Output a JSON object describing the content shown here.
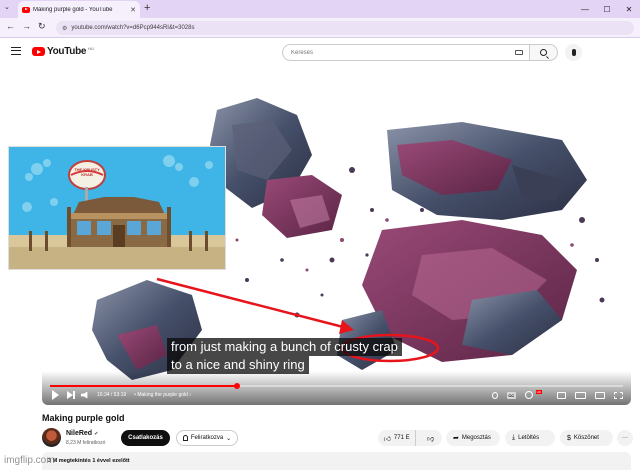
{
  "browser": {
    "tab_title": "Making purple gold - YouTube",
    "tab_close": "✕",
    "new_tab": "+",
    "tab_list": "⌄",
    "url": "youtube.com/watch?v=d6Pcp944sRI&t=3028s",
    "win_min": "—",
    "win_max": "☐",
    "win_close": "✕"
  },
  "header": {
    "logo_text": "YouTube",
    "logo_country": "HU",
    "search_placeholder": "Keresés"
  },
  "player": {
    "progress": 0.327,
    "time": "16:34 / 53:19",
    "chapter": "• Making the purple gold  ›",
    "captions": [
      "from just making a bunch of crusty crap",
      "to a nice and shiny ring"
    ],
    "inset_sign": "THE KRUSTY KRAB",
    "accent": "#ff0000",
    "annotation_color": "#e8141c"
  },
  "video": {
    "title": "Making purple gold",
    "channel": "NileRed",
    "verified": "✔",
    "subscribers": "8,23 M feliratkozó",
    "join_label": "Csatlakozás",
    "subscribe_label": "Feliratkozva",
    "likes": "771 E",
    "share_label": "Megosztás",
    "download_label": "Letöltés",
    "thanks_label": "Köszönet",
    "more_label": "···",
    "description_meta": "3 M megtekintés  1 évvel ezelőtt"
  },
  "watermark": "imgflip.com"
}
